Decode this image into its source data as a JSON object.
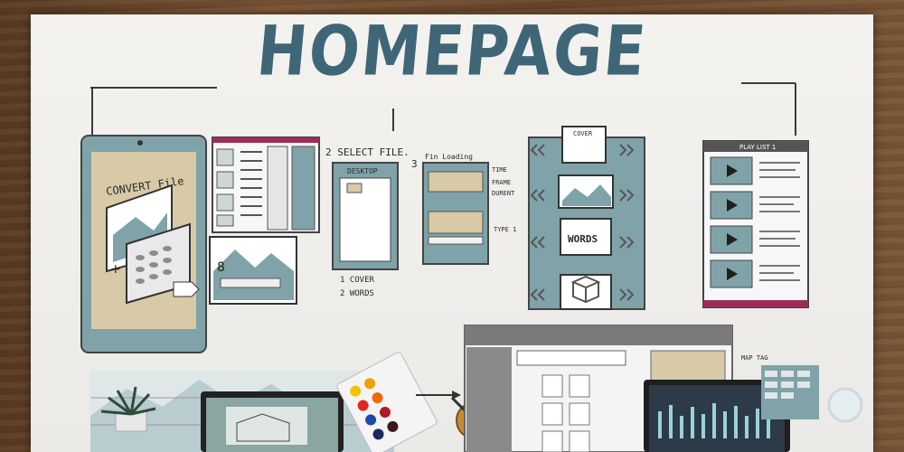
{
  "poster": {
    "title": "HOMEPAGE",
    "tablet_label": "CONVERT File",
    "step2_label": "2 SELECT FILE.",
    "step2_window_title": "DESKTOP",
    "step2_options": [
      "1 COVER",
      "2 WORDS"
    ],
    "step3_label": "3",
    "step3_header": "Fin Loading",
    "step3_notes": [
      "TIME",
      "FRAME",
      "DURENT",
      "TYPE 1"
    ],
    "carousel_items": [
      "COVER",
      "WORDS"
    ],
    "playlist_title": "PLAY LIST 1",
    "bottom_note": "MAP TAG"
  },
  "colors": {
    "accent": "#3f6676",
    "panel": "#7fa3a8",
    "sand": "#d8c9a7",
    "magenta": "#9b2d5a",
    "ink": "#2a2a2a"
  }
}
